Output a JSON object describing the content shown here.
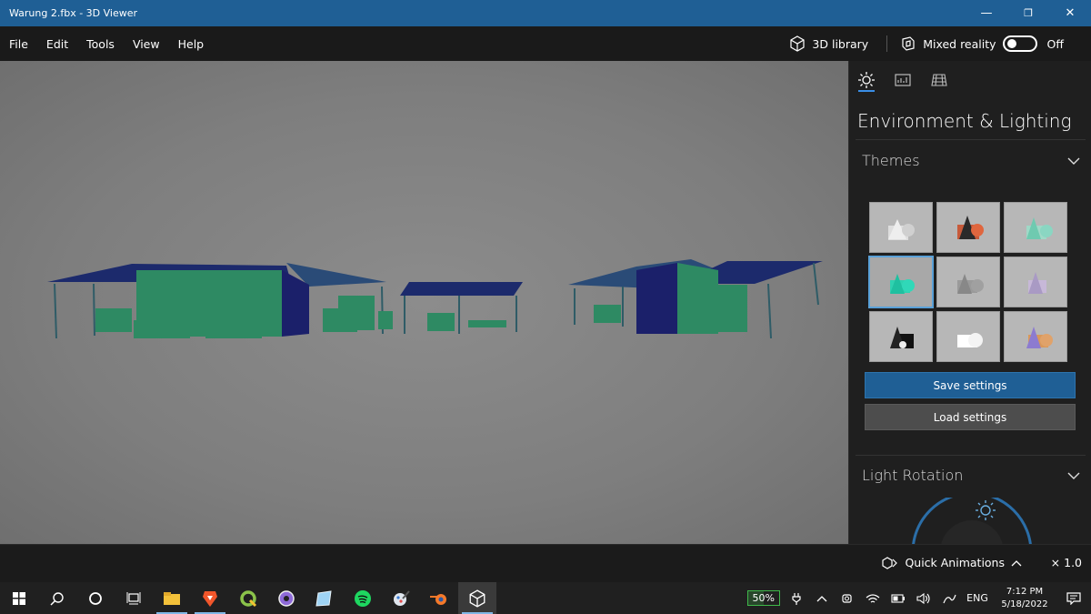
{
  "window": {
    "title": "Warung 2.fbx - 3D Viewer",
    "minimize": "—",
    "maximize": "❐",
    "close": "✕"
  },
  "menu": {
    "items": [
      "File",
      "Edit",
      "Tools",
      "View",
      "Help"
    ],
    "library_label": "3D library",
    "mixed_reality_label": "Mixed reality",
    "mixed_reality_state": "Off"
  },
  "panel": {
    "title": "Environment & Lighting",
    "themes_label": "Themes",
    "save_label": "Save settings",
    "load_label": "Load settings",
    "light_rotation_label": "Light Rotation",
    "selected_theme_index": 3
  },
  "bottom": {
    "quick_animations_label": "Quick Animations",
    "speed_label": "× 1.0"
  },
  "taskbar": {
    "battery_percent": "50%",
    "language": "ENG",
    "time": "7:12 PM",
    "date": "5/18/2022"
  },
  "colors": {
    "accent": "#1f5f95",
    "model_teal": "#2a8a6a",
    "model_navy": "#1a1f6e"
  }
}
